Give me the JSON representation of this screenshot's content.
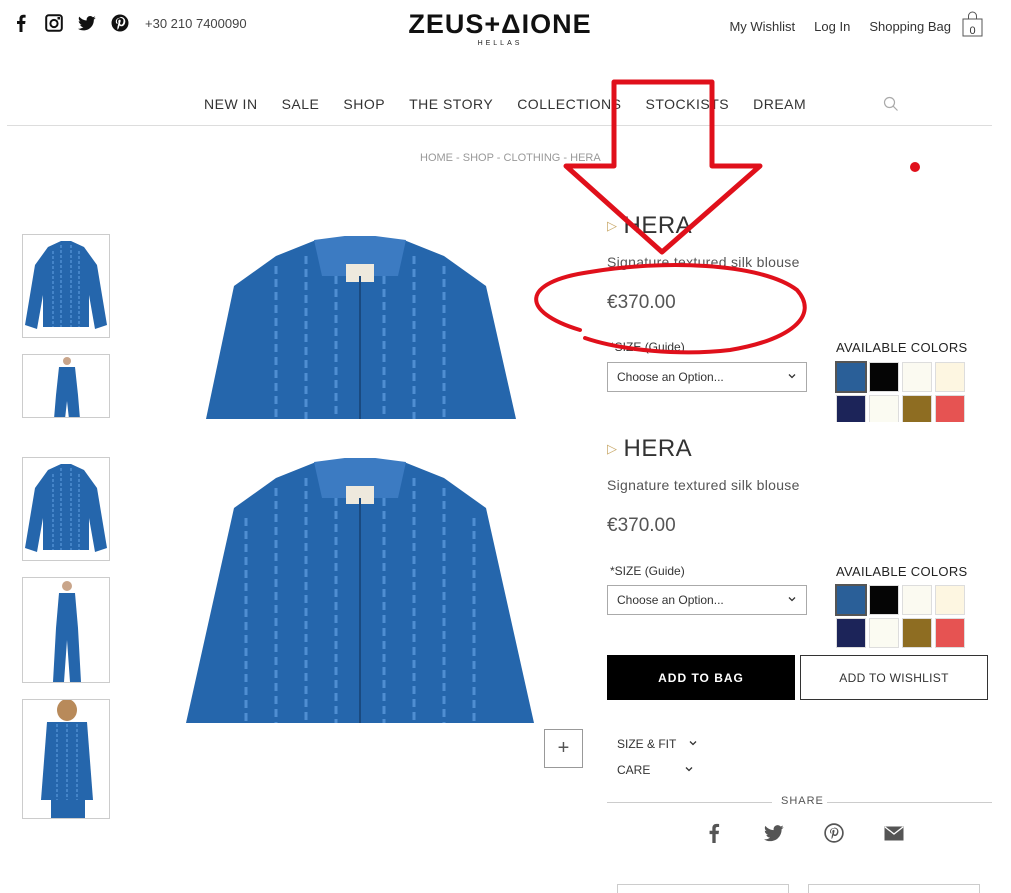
{
  "header": {
    "social_icons": [
      "facebook-icon",
      "instagram-icon",
      "twitter-icon",
      "pinterest-icon"
    ],
    "phone": "+30 210 7400090",
    "logo_main": "ZEUS+ΔIONE",
    "logo_sub": "HELLAS",
    "links": {
      "wishlist": "My Wishlist",
      "login": "Log In",
      "bag": "Shopping Bag"
    },
    "bag_count": "0"
  },
  "nav": {
    "items": [
      "NEW IN",
      "SALE",
      "SHOP",
      "THE STORY",
      "COLLECTIONS",
      "STOCKISTS",
      "DREAM"
    ],
    "search_icon": "search-icon"
  },
  "breadcrumb": "HOME - SHOP - CLOTHING - HERA",
  "product": {
    "title": "HERA",
    "description": "Signature textured silk blouse",
    "price": "€370.00",
    "size_label": "*SIZE ",
    "size_guide": "(Guide)",
    "size_placeholder": "Choose an Option...",
    "colors_label": "AVAILABLE COLORS",
    "colors": [
      "#2a5f98",
      "#050505",
      "#fbfaf1",
      "#fdf6e1",
      "#1c2459",
      "#fbfbf2",
      "#8e6d22",
      "#e65352"
    ],
    "selected_color_index": 0,
    "add_to_bag": "ADD TO BAG",
    "add_to_wishlist": "ADD TO WISHLIST",
    "accordion": [
      "SIZE & FIT",
      "CARE"
    ],
    "share_label": "SHARE",
    "share_icons": [
      "facebook-icon",
      "twitter-icon",
      "pinterest-icon",
      "email-icon"
    ],
    "zoom_label": "+"
  },
  "colors": {
    "accent": "#e0101b",
    "product_blue": "#2566ac",
    "stripe_blue": "#4f8ed2",
    "gold": "#c9a96a"
  }
}
